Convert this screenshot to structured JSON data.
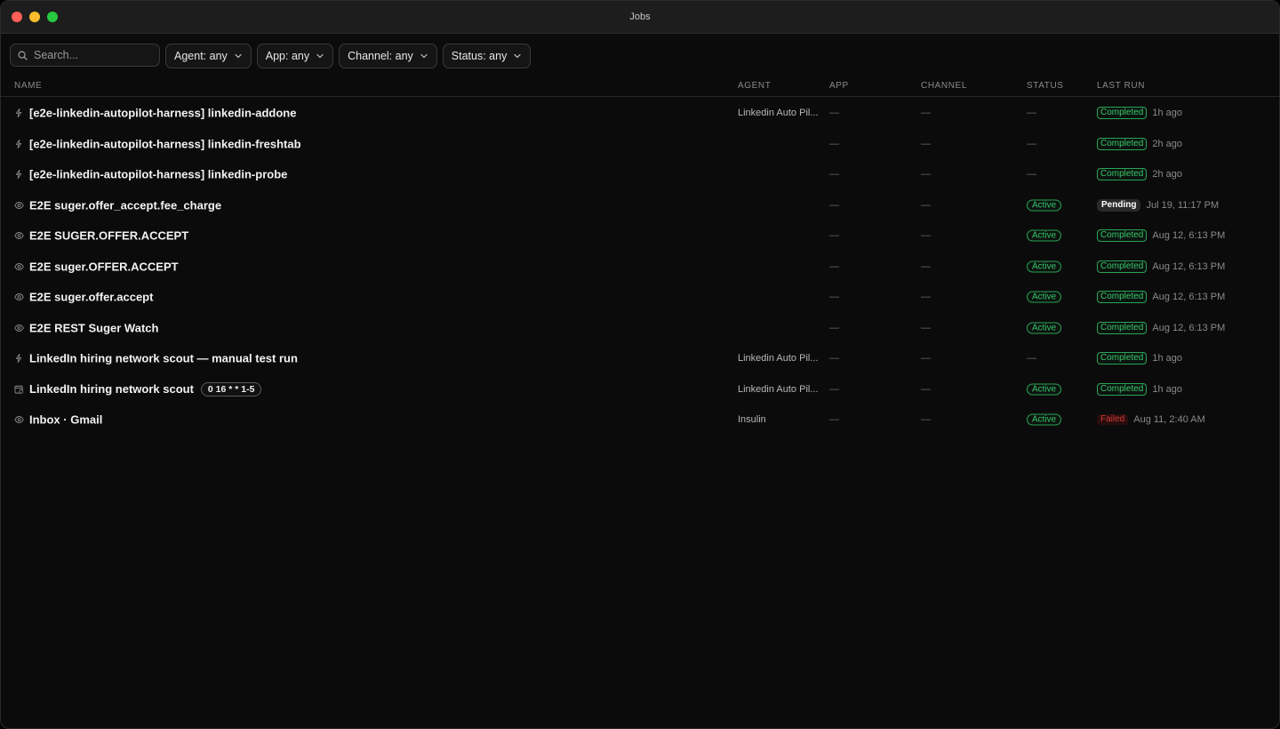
{
  "window": {
    "title": "Jobs"
  },
  "toolbar": {
    "search_placeholder": "Search...",
    "filters": [
      {
        "label": "Agent: any"
      },
      {
        "label": "App: any"
      },
      {
        "label": "Channel: any"
      },
      {
        "label": "Status: any"
      }
    ]
  },
  "table": {
    "columns": [
      "NAME",
      "AGENT",
      "APP",
      "CHANNEL",
      "STATUS",
      "LAST RUN"
    ],
    "rows": [
      {
        "icon": "bolt-icon",
        "name": "[e2e-linkedin-autopilot-harness] linkedin-addone",
        "cron": "",
        "agent": "Linkedin Auto Pil...",
        "app": "—",
        "channel": "—",
        "status": "—",
        "status_type": "none",
        "run_badge": "Completed",
        "run_type": "completed",
        "run_time": "1h ago"
      },
      {
        "icon": "bolt-icon",
        "name": "[e2e-linkedin-autopilot-harness] linkedin-freshtab",
        "cron": "",
        "agent": "",
        "app": "—",
        "channel": "—",
        "status": "—",
        "status_type": "none",
        "run_badge": "Completed",
        "run_type": "completed",
        "run_time": "2h ago"
      },
      {
        "icon": "bolt-icon",
        "name": "[e2e-linkedin-autopilot-harness] linkedin-probe",
        "cron": "",
        "agent": "",
        "app": "—",
        "channel": "—",
        "status": "—",
        "status_type": "none",
        "run_badge": "Completed",
        "run_type": "completed",
        "run_time": "2h ago"
      },
      {
        "icon": "eye-icon",
        "name": "E2E suger.offer_accept.fee_charge",
        "cron": "",
        "agent": "",
        "app": "—",
        "channel": "—",
        "status": "Active",
        "status_type": "active",
        "run_badge": "Pending",
        "run_type": "pending",
        "run_time": "Jul 19, 11:17 PM"
      },
      {
        "icon": "eye-icon",
        "name": "E2E SUGER.OFFER.ACCEPT",
        "cron": "",
        "agent": "",
        "app": "—",
        "channel": "—",
        "status": "Active",
        "status_type": "active",
        "run_badge": "Completed",
        "run_type": "completed",
        "run_time": "Aug 12, 6:13 PM"
      },
      {
        "icon": "eye-icon",
        "name": "E2E suger.OFFER.ACCEPT",
        "cron": "",
        "agent": "",
        "app": "—",
        "channel": "—",
        "status": "Active",
        "status_type": "active",
        "run_badge": "Completed",
        "run_type": "completed",
        "run_time": "Aug 12, 6:13 PM"
      },
      {
        "icon": "eye-icon",
        "name": "E2E suger.offer.accept",
        "cron": "",
        "agent": "",
        "app": "—",
        "channel": "—",
        "status": "Active",
        "status_type": "active",
        "run_badge": "Completed",
        "run_type": "completed",
        "run_time": "Aug 12, 6:13 PM"
      },
      {
        "icon": "eye-icon",
        "name": "E2E REST Suger Watch",
        "cron": "",
        "agent": "",
        "app": "—",
        "channel": "—",
        "status": "Active",
        "status_type": "active",
        "run_badge": "Completed",
        "run_type": "completed",
        "run_time": "Aug 12, 6:13 PM"
      },
      {
        "icon": "bolt-icon",
        "name": "LinkedIn hiring network scout — manual test run",
        "cron": "",
        "agent": "Linkedin Auto Pil...",
        "app": "—",
        "channel": "—",
        "status": "—",
        "status_type": "none",
        "run_badge": "Completed",
        "run_type": "completed",
        "run_time": "1h ago"
      },
      {
        "icon": "calendar-clock-icon",
        "name": "LinkedIn hiring network scout",
        "cron": "0 16 * * 1-5",
        "agent": "Linkedin Auto Pil...",
        "app": "—",
        "channel": "—",
        "status": "Active",
        "status_type": "active",
        "run_badge": "Completed",
        "run_type": "completed",
        "run_time": "1h ago"
      },
      {
        "icon": "eye-icon",
        "name": "Inbox · Gmail",
        "cron": "",
        "agent": "Insulin",
        "app": "—",
        "channel": "—",
        "status": "Active",
        "status_type": "active",
        "run_badge": "Failed",
        "run_type": "failed",
        "run_time": "Aug 11, 2:40 AM"
      }
    ]
  }
}
